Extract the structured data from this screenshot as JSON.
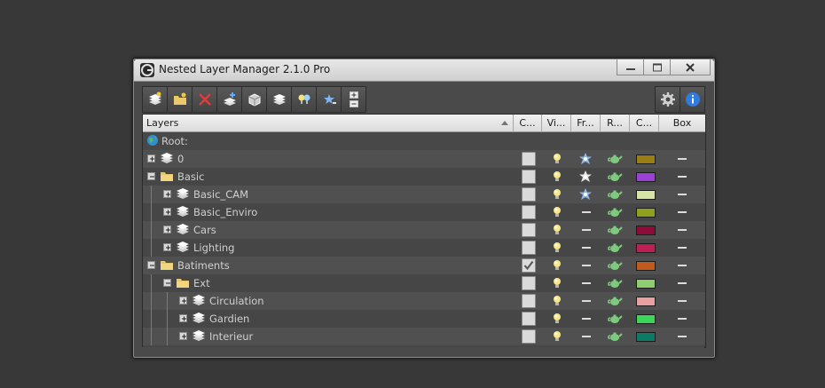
{
  "window": {
    "title": "Nested Layer Manager 2.1.0 Pro"
  },
  "toolbar": {
    "left_buttons": [
      {
        "icon": "new-layer-icon"
      },
      {
        "icon": "new-folder-icon"
      },
      {
        "icon": "delete-icon"
      },
      {
        "icon": "add-selection-icon"
      },
      {
        "icon": "select-objects-icon"
      },
      {
        "icon": "layer-properties-icon"
      },
      {
        "icon": "light-bulbs-icon"
      },
      {
        "icon": "isolate-icon"
      },
      {
        "icon": "expand-collapse-icon"
      }
    ],
    "right_buttons": [
      {
        "icon": "gear-icon"
      },
      {
        "icon": "info-icon"
      }
    ]
  },
  "columns": {
    "layers": "Layers",
    "current": "C...",
    "visible": "Vi...",
    "freeze": "Fr...",
    "render": "R...",
    "color": "C...",
    "box": "Box"
  },
  "root_label": "Root:",
  "rows": [
    {
      "name": "0",
      "type": "layer",
      "level": 0,
      "expanded": false,
      "current": false,
      "visible": true,
      "frozen": "star",
      "color": "#9a7d14",
      "box": "dash"
    },
    {
      "name": "Basic",
      "type": "folder",
      "level": 0,
      "expanded": true,
      "current": false,
      "visible": true,
      "frozen": "star-light",
      "color": "#9b42d6",
      "box": "dash"
    },
    {
      "name": "Basic_CAM",
      "type": "layer",
      "level": 1,
      "expanded": false,
      "current": false,
      "visible": true,
      "frozen": "star",
      "color": "#d6e4a4",
      "box": "dash"
    },
    {
      "name": "Basic_Enviro",
      "type": "layer",
      "level": 1,
      "expanded": false,
      "current": false,
      "visible": true,
      "frozen": "none",
      "color": "#8ea01c",
      "box": "dash"
    },
    {
      "name": "Cars",
      "type": "layer",
      "level": 1,
      "expanded": false,
      "current": false,
      "visible": true,
      "frozen": "none",
      "color": "#8c0d3a",
      "box": "dash"
    },
    {
      "name": "Lighting",
      "type": "layer",
      "level": 1,
      "expanded": false,
      "current": false,
      "visible": true,
      "frozen": "none",
      "color": "#c01f55",
      "box": "dash"
    },
    {
      "name": "Batiments",
      "type": "folder",
      "level": 0,
      "expanded": true,
      "current": true,
      "visible": true,
      "frozen": "none",
      "color": "#c05a1e",
      "box": "dash"
    },
    {
      "name": "Ext",
      "type": "folder",
      "level": 1,
      "expanded": true,
      "current": false,
      "visible": true,
      "frozen": "none",
      "color": "#8ece6c",
      "box": "dash"
    },
    {
      "name": "Circulation",
      "type": "layer",
      "level": 2,
      "expanded": false,
      "current": false,
      "visible": true,
      "frozen": "none",
      "color": "#e8a0a0",
      "box": "dash"
    },
    {
      "name": "Gardien",
      "type": "layer",
      "level": 2,
      "expanded": false,
      "current": false,
      "visible": true,
      "frozen": "none",
      "color": "#3ad65a",
      "box": "dash"
    },
    {
      "name": "Interieur",
      "type": "layer",
      "level": 2,
      "expanded": false,
      "current": false,
      "visible": true,
      "frozen": "none",
      "color": "#0f7a63",
      "box": "dash"
    }
  ]
}
